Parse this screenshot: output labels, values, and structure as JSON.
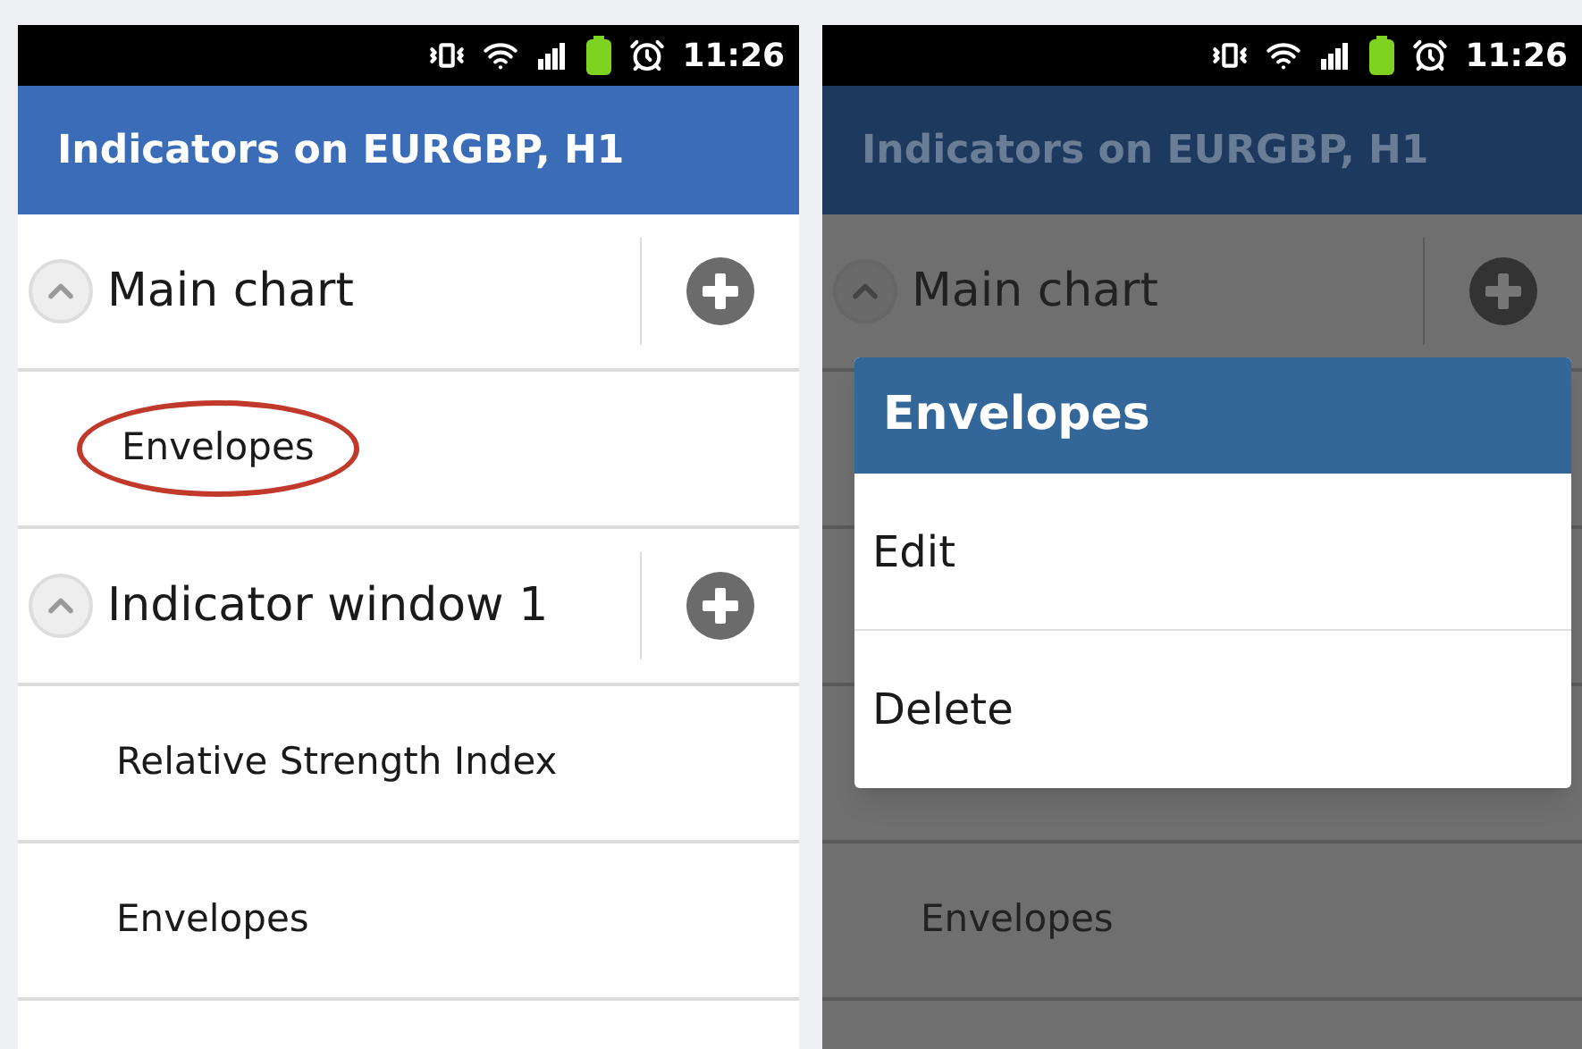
{
  "screens": [
    {
      "dimmed": false,
      "status_bar": {
        "time": "11:26"
      },
      "title": "Indicators on EURGBP, H1",
      "rows": [
        {
          "kind": "header",
          "label": "Main chart"
        },
        {
          "kind": "item",
          "label": "Envelopes",
          "circled": true
        },
        {
          "kind": "header",
          "label": "Indicator window 1"
        },
        {
          "kind": "item",
          "label": "Relative Strength Index",
          "circled": false
        },
        {
          "kind": "item",
          "label": "Envelopes",
          "circled": false
        }
      ]
    },
    {
      "dimmed": true,
      "status_bar": {
        "time": "11:26"
      },
      "title": "Indicators on EURGBP, H1",
      "rows": [
        {
          "kind": "header",
          "label": "Main chart"
        },
        {
          "kind": "covered"
        },
        {
          "kind": "covered"
        },
        {
          "kind": "covered"
        },
        {
          "kind": "item",
          "label": "Envelopes",
          "circled": false
        }
      ],
      "dialog": {
        "title": "Envelopes",
        "options": [
          "Edit",
          "Delete"
        ]
      }
    }
  ]
}
